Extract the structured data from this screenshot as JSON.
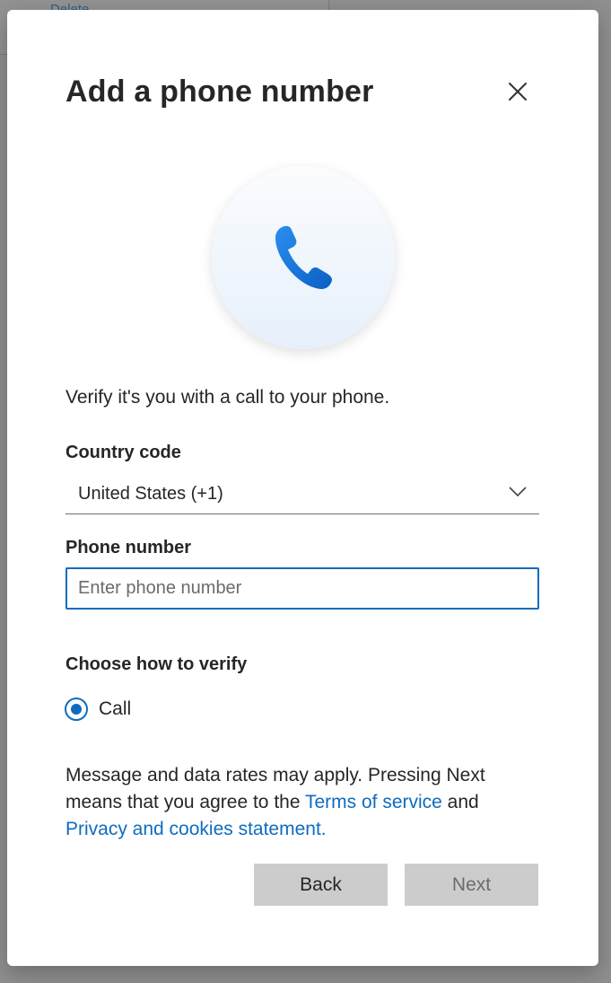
{
  "backdrop": {
    "link_text": "Delete"
  },
  "dialog": {
    "title": "Add a phone number",
    "close_icon": "close-icon",
    "hero_icon": "phone-icon",
    "intro_text": "Verify it's you with a call to your phone.",
    "country": {
      "label": "Country code",
      "value": "United States (+1)",
      "icon": "chevron-down-icon"
    },
    "phone": {
      "label": "Phone number",
      "placeholder": "Enter phone number",
      "value": ""
    },
    "verify": {
      "label": "Choose how to verify",
      "options": [
        {
          "label": "Call",
          "selected": true
        }
      ]
    },
    "disclaimer": {
      "text_before": "Message and data rates may apply. Pressing Next means that you agree to the ",
      "terms_link": "Terms of service",
      "text_middle": " and ",
      "privacy_link": "Privacy and cookies statement."
    },
    "buttons": {
      "back_label": "Back",
      "next_label": "Next",
      "next_disabled": true
    }
  },
  "colors": {
    "accent": "#0E6CC0",
    "button_bg": "#CCCCCC",
    "text": "#262626",
    "overlay": "#8F8F8F"
  }
}
